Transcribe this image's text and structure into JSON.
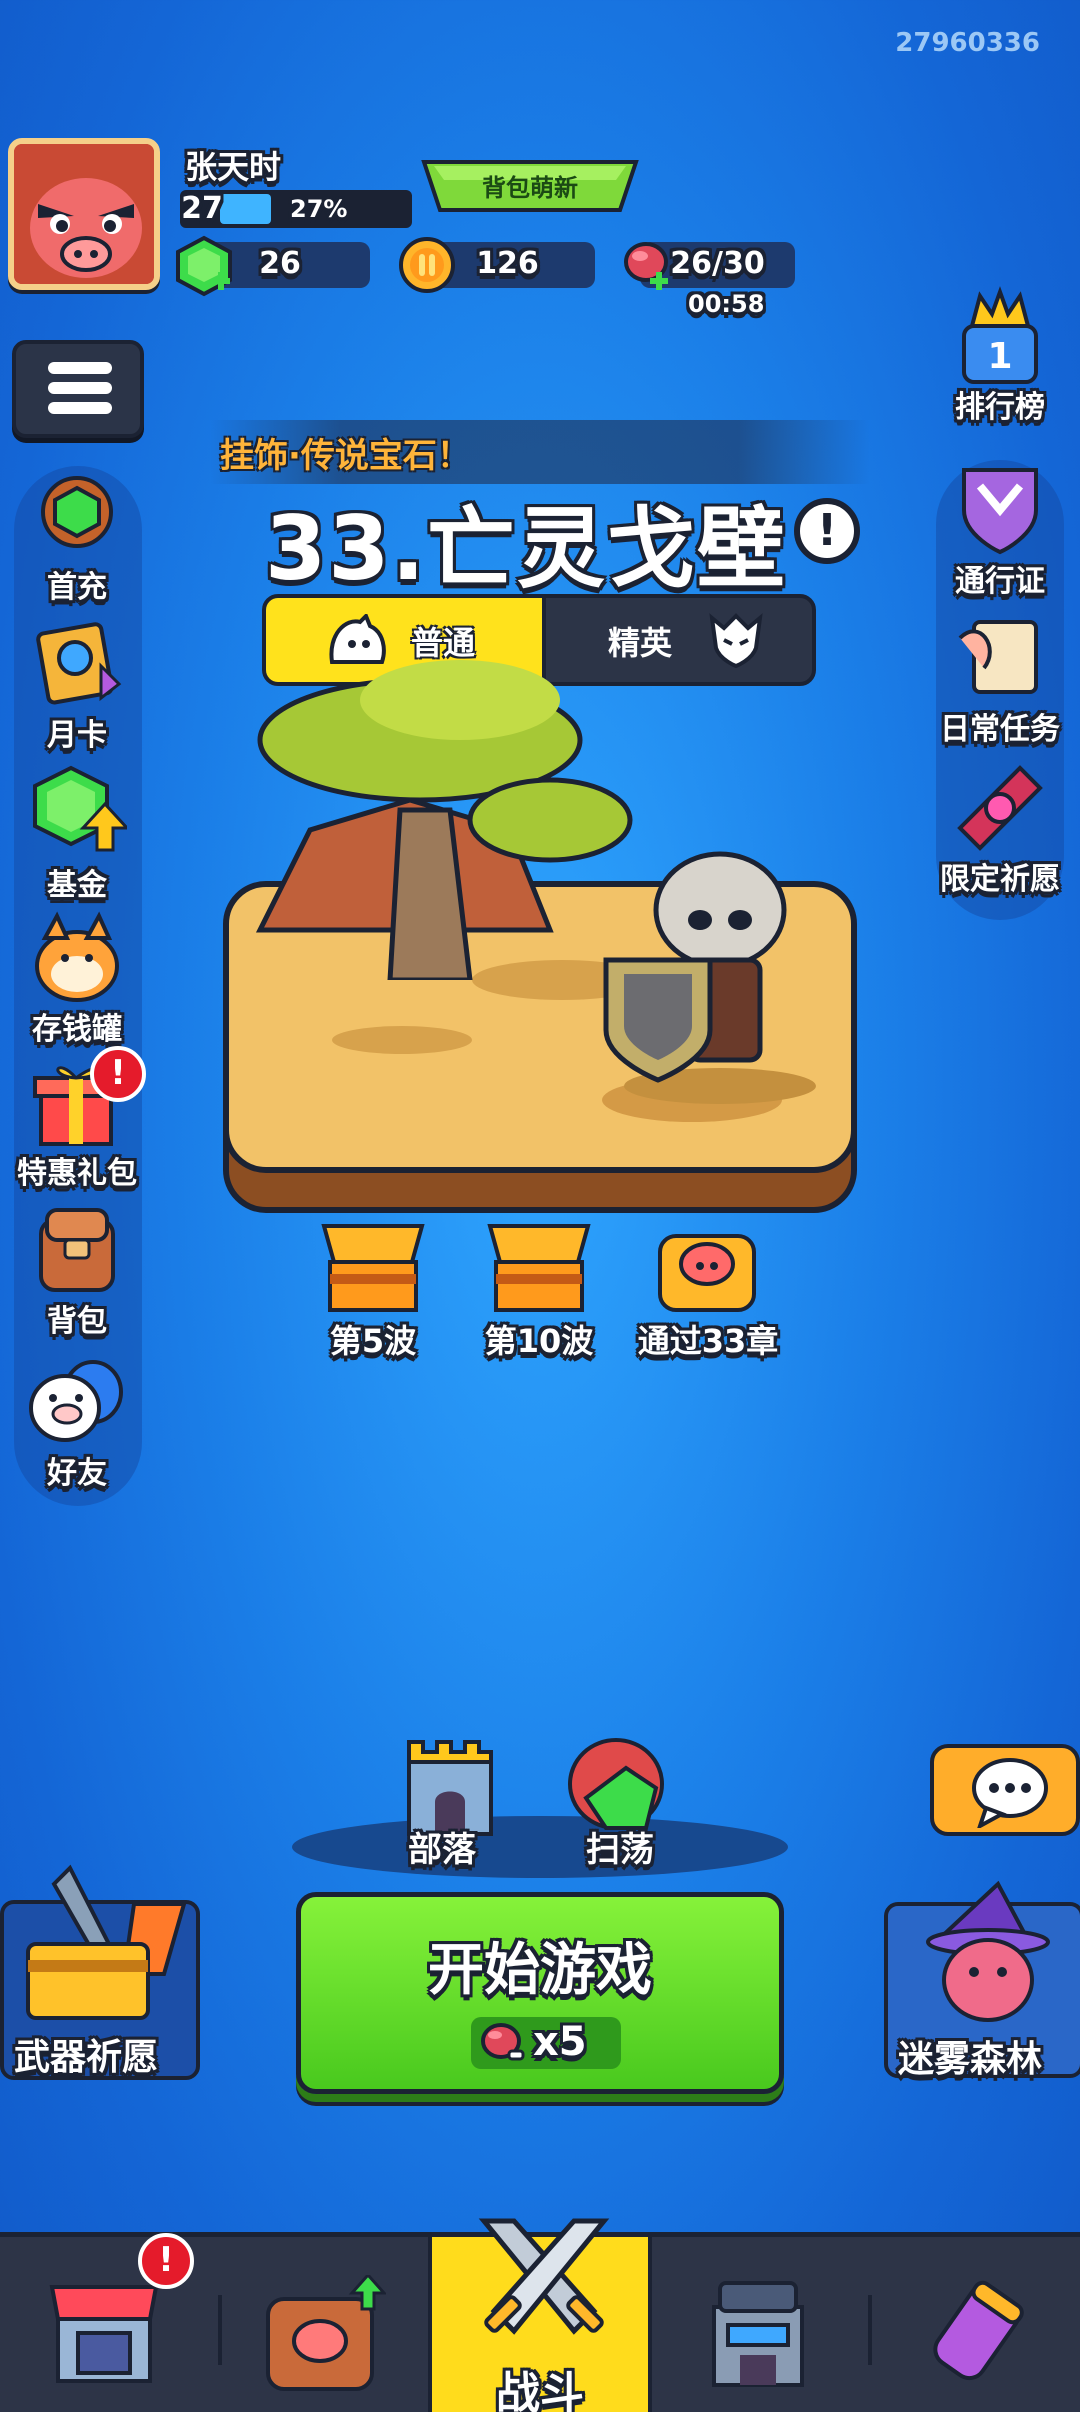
{
  "top": {
    "id_text": "27960336",
    "player_name": "张天时",
    "level": "27",
    "level_progress_pct": "27%",
    "level_progress": 0.27,
    "banner_label": "背包萌新",
    "resources": {
      "gems": "26",
      "coins": "126",
      "stamina": "26/30",
      "stamina_timer": "00:58"
    }
  },
  "left_menu": [
    {
      "label": "首充",
      "icon": "first-recharge-icon"
    },
    {
      "label": "月卡",
      "icon": "monthly-card-icon"
    },
    {
      "label": "基金",
      "icon": "fund-icon"
    },
    {
      "label": "存钱罐",
      "icon": "piggy-bank-icon"
    },
    {
      "label": "特惠礼包",
      "icon": "gift-pack-icon",
      "badge": "!"
    },
    {
      "label": "背包",
      "icon": "backpack-icon"
    },
    {
      "label": "好友",
      "icon": "friends-icon"
    }
  ],
  "right_menu": [
    {
      "label": "排行榜",
      "icon": "leaderboard-icon"
    },
    {
      "label": "通行证",
      "icon": "pass-icon"
    },
    {
      "label": "日常任务",
      "icon": "daily-quest-icon"
    },
    {
      "label": "限定祈愿",
      "icon": "limited-wish-icon"
    }
  ],
  "stage": {
    "subtitle": "挂饰·传说宝石！",
    "title": "33.亡灵戈壁",
    "info": "!",
    "modes": {
      "normal": "普通",
      "elite": "精英"
    }
  },
  "rewards": [
    {
      "label": "第5波",
      "icon": "chest-icon"
    },
    {
      "label": "第10波",
      "icon": "chest-icon"
    },
    {
      "label": "通过33章",
      "icon": "pig-chest-icon"
    }
  ],
  "actions": {
    "tribe": "部落",
    "sweep": "扫荡",
    "start": "开始游戏",
    "start_cost": "x5",
    "weapon_wish": "迷雾森林",
    "weapon_wish_left": "武器祈愿"
  },
  "nav": {
    "shop_badge": "!",
    "battle": "战斗"
  },
  "colors": {
    "accent_yellow": "#ffdc1c",
    "start_green": "#5ad424",
    "bg_blue": "#1b7fe8"
  }
}
